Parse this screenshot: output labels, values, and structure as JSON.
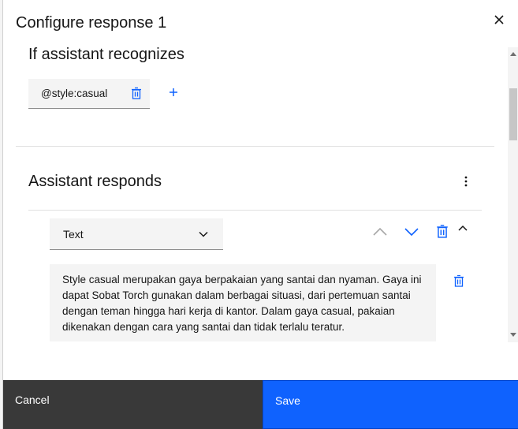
{
  "modal": {
    "title": "Configure response 1",
    "close_icon": "close-icon"
  },
  "recognizes": {
    "heading": "If assistant recognizes",
    "condition": "@style:casual",
    "delete_icon": "trash-icon",
    "add_icon": "plus-icon"
  },
  "responds": {
    "heading": "Assistant responds",
    "menu_icon": "overflow-menu-icon",
    "response_type": "Text",
    "controls": [
      "chevron-up-icon",
      "chevron-down-icon",
      "trash-icon",
      "collapse-icon"
    ],
    "text": "Style casual merupakan gaya berpakaian yang santai dan nyaman. Gaya ini dapat Sobat Torch gunakan dalam berbagai situasi, dari pertemuan santai dengan teman hingga hari kerja di kantor. Dalam gaya casual, pakaian dikenakan dengan cara yang santai dan tidak terlalu teratur."
  },
  "footer": {
    "cancel_label": "Cancel",
    "save_label": "Save"
  },
  "colors": {
    "primary": "#0f62fe",
    "secondary": "#393939",
    "field_bg": "#f4f4f4"
  }
}
